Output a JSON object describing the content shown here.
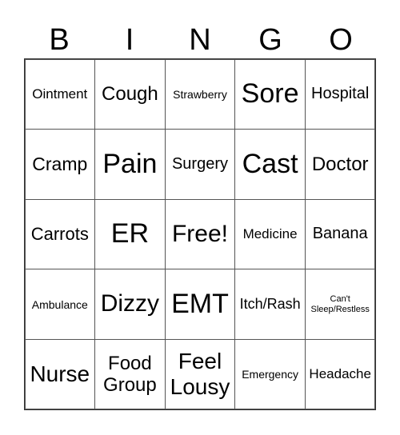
{
  "header": [
    "B",
    "I",
    "N",
    "G",
    "O"
  ],
  "cells": [
    "Ointment",
    "Cough",
    "Strawberry",
    "Sore",
    "Hospital",
    "Cramp",
    "Pain",
    "Surgery",
    "Cast",
    "Doctor",
    "Carrots",
    "ER",
    "Free!",
    "Medicine",
    "Banana",
    "Ambulance",
    "Dizzy",
    "EMT",
    "Itch/Rash",
    "Can't Sleep/Restless",
    "Nurse",
    "Food Group",
    "Feel Lousy",
    "Emergency",
    "Headache"
  ]
}
